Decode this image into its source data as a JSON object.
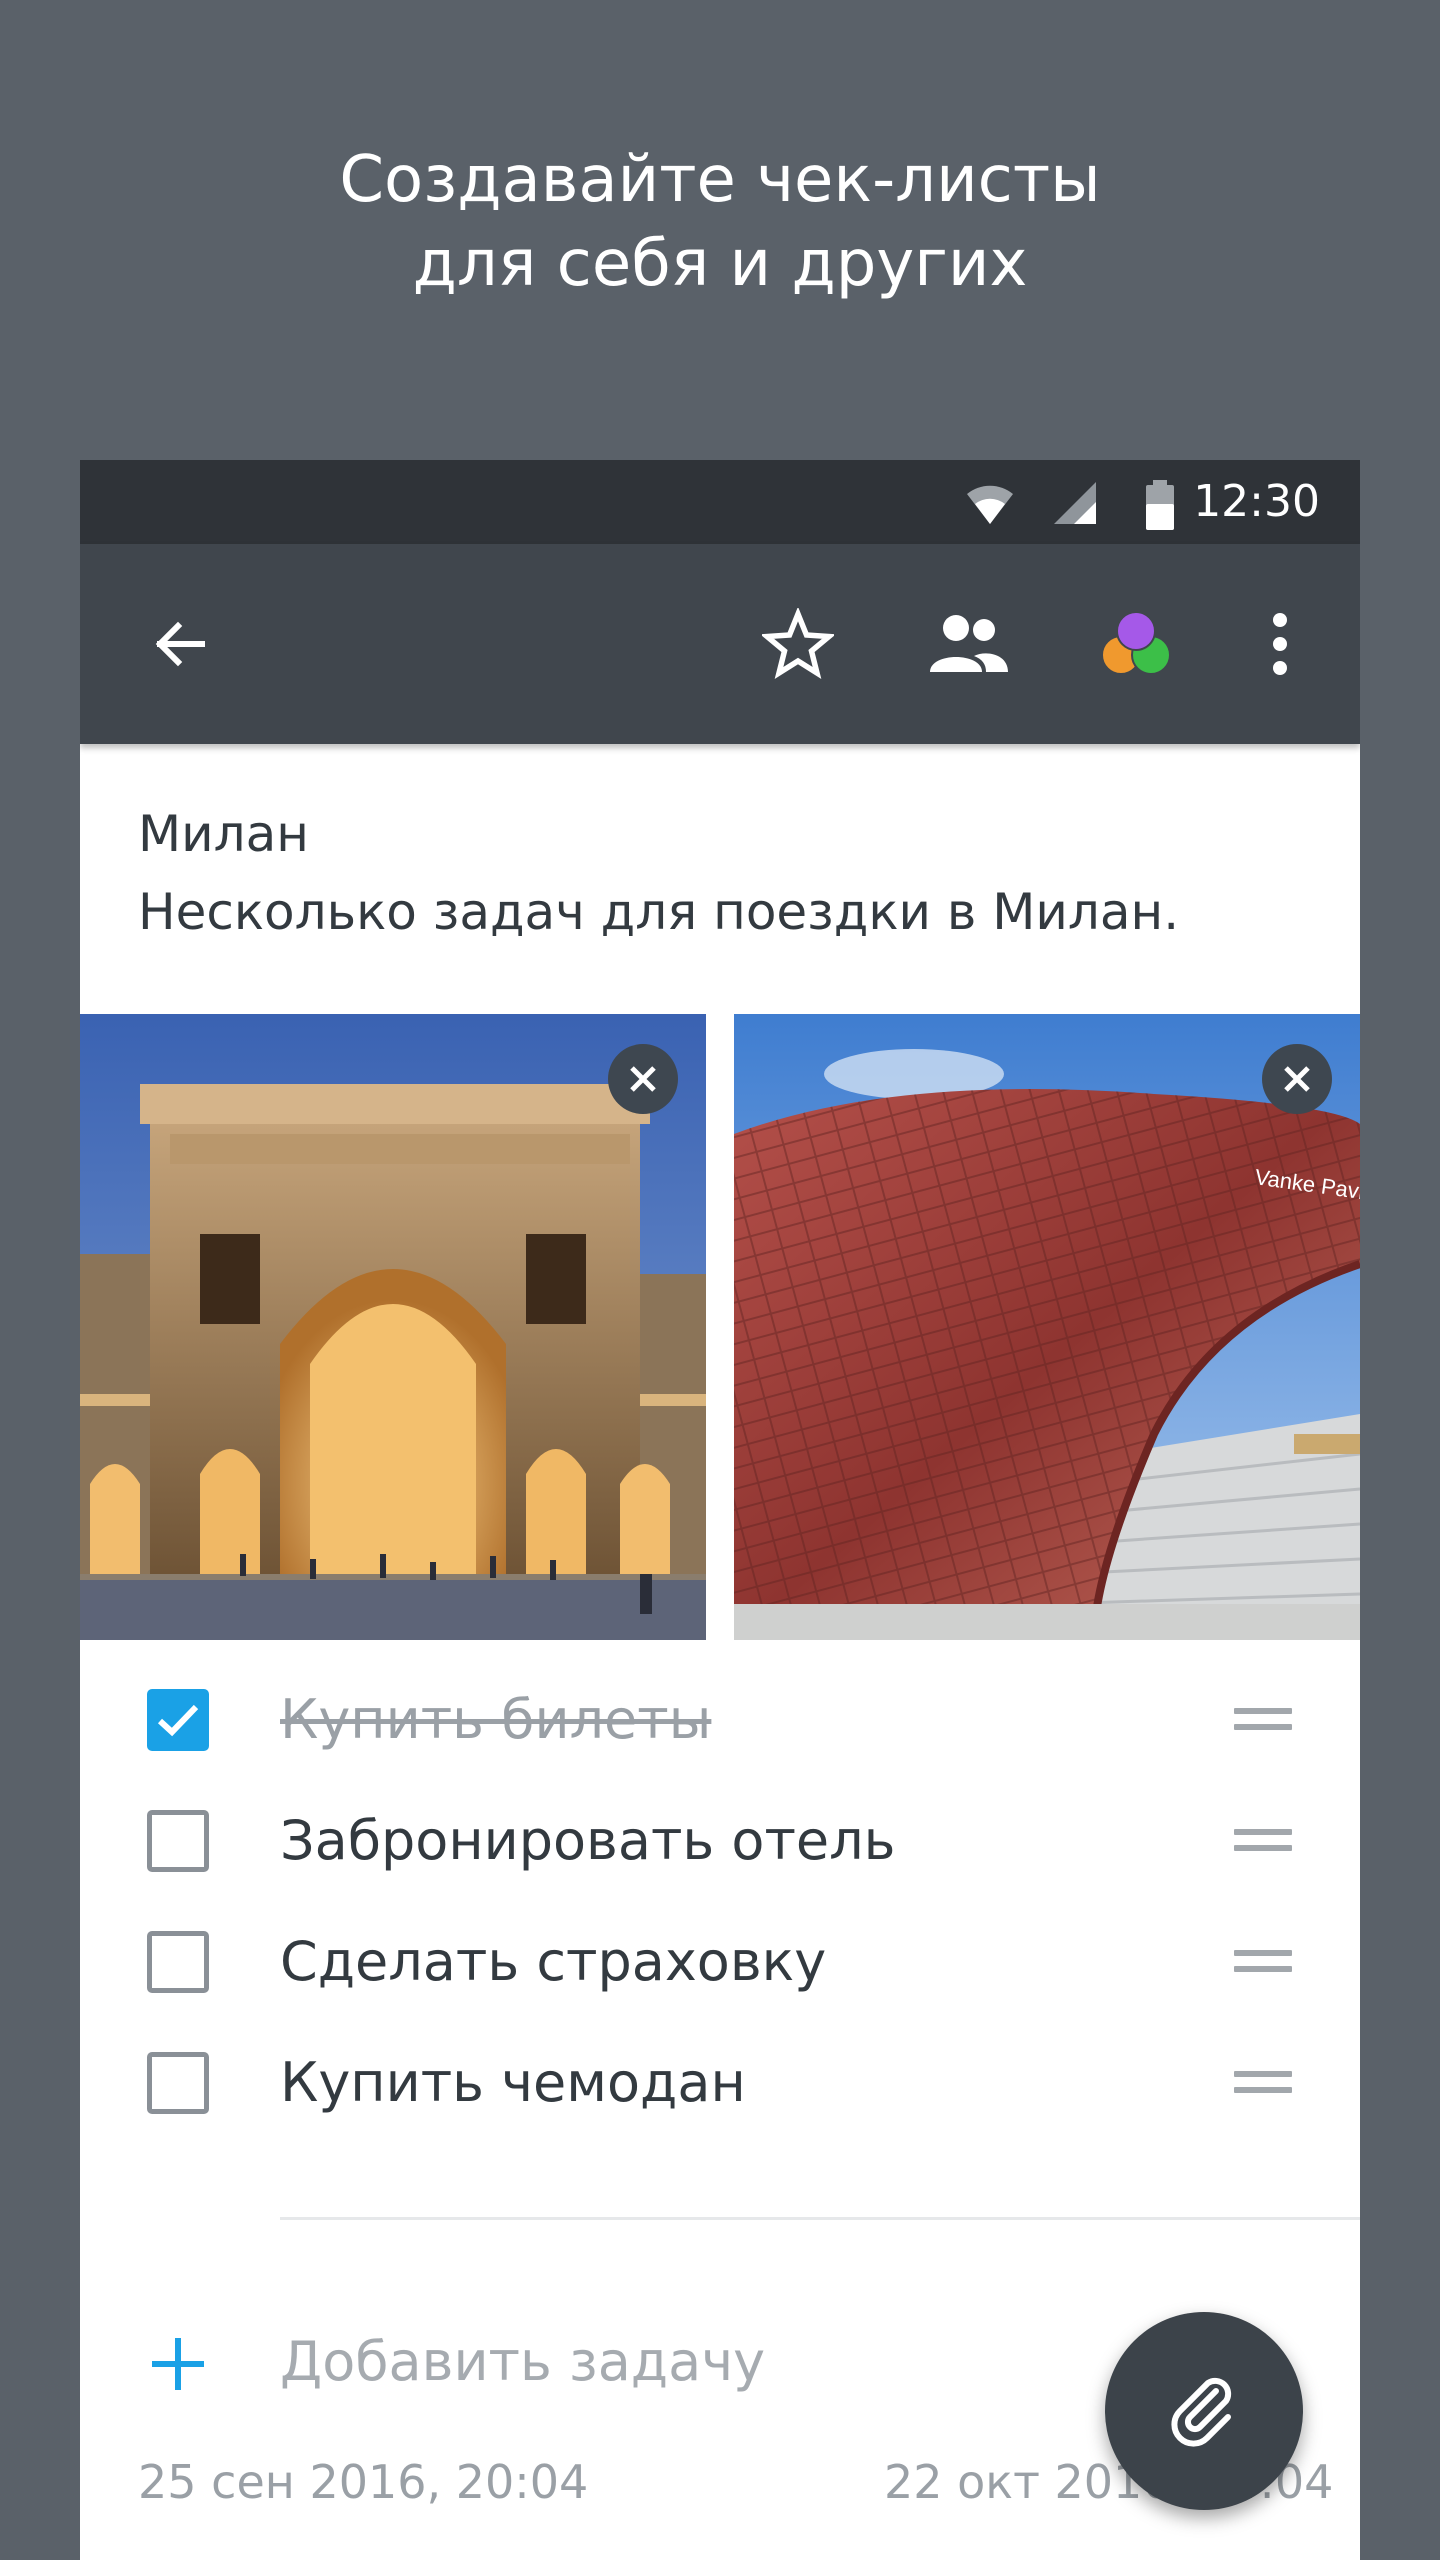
{
  "promo": {
    "line1": "Создавайте чек-листы",
    "line2": "для себя и других"
  },
  "status_bar": {
    "time": "12:30",
    "icons": [
      "wifi-icon",
      "cellular-signal-icon",
      "battery-icon"
    ]
  },
  "toolbar": {
    "icons": [
      "back-arrow-icon",
      "star-outline-icon",
      "people-icon",
      "color-palette-icon",
      "more-vert-icon"
    ],
    "palette_colors": [
      "#f0992e",
      "#3cbf48",
      "#a559e8"
    ]
  },
  "note": {
    "title": "Милан",
    "body": "Несколько задач для поездки в Милан."
  },
  "photos": [
    {
      "subject": "Galleria Vittorio Emanuele II arch at dusk",
      "remove_icon": "close-icon"
    },
    {
      "subject": "Red scaled curved pavilion",
      "remove_icon": "close-icon",
      "sign_text": "Vanke Pavilion"
    }
  ],
  "tasks": [
    {
      "label": "Купить билеты",
      "checked": true
    },
    {
      "label": "Забронировать отель",
      "checked": false
    },
    {
      "label": "Сделать страховку",
      "checked": false
    },
    {
      "label": "Купить чемодан",
      "checked": false
    }
  ],
  "add_task": {
    "label": "Добавить задачу"
  },
  "dates": {
    "created": "25 сен 2016, 20:04",
    "modified": "22 окт 2016, 14:04"
  },
  "fab": {
    "icon": "paperclip-icon"
  },
  "colors": {
    "background": "#5a6169",
    "status_bar": "#2f3338",
    "toolbar": "#40464d",
    "accent": "#1aa1e6"
  }
}
